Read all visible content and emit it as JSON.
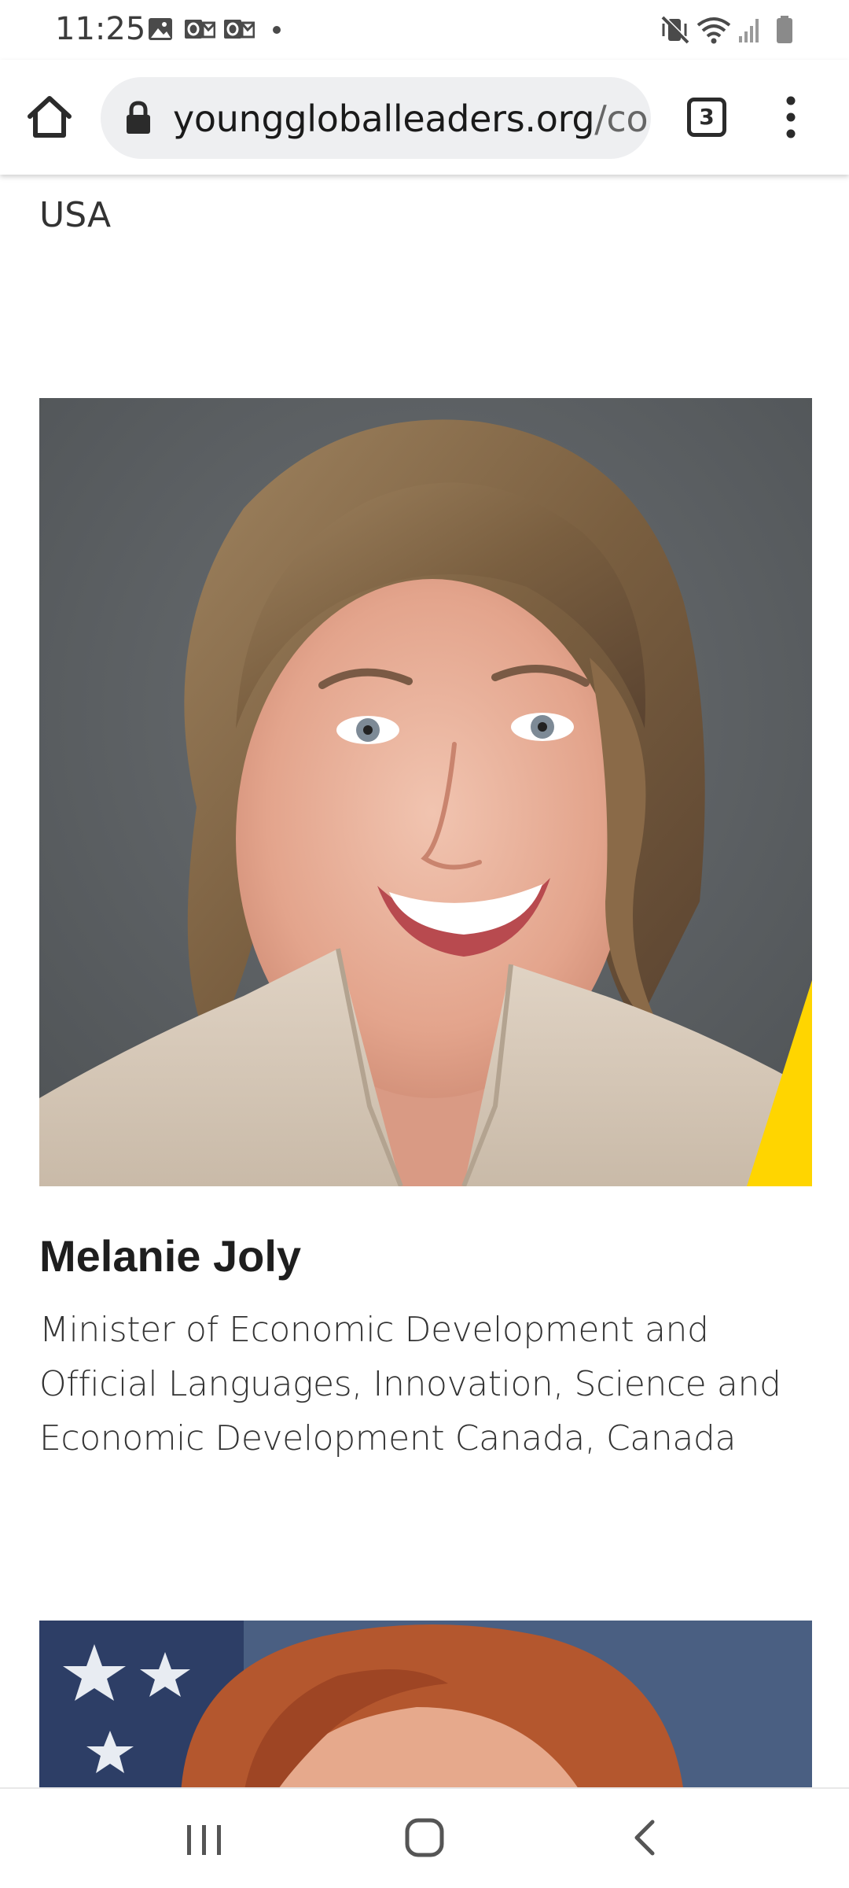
{
  "status_bar": {
    "time": "11:25",
    "notification_icons": [
      "image-icon",
      "outlook-icon",
      "outlook-icon",
      "dot-icon"
    ],
    "system_icons": [
      "vibrate-icon",
      "wifi-icon",
      "signal-icon",
      "battery-icon"
    ]
  },
  "browser": {
    "url_domain": "younggloballeaders.org",
    "url_path": "/com",
    "tab_count": "3"
  },
  "content": {
    "previous_entry_country": "USA",
    "profile": {
      "name": "Melanie Joly",
      "role": "Minister of Economic Development and Official Languages, Innovation, Science and Economic Development Canada, Canada"
    }
  },
  "colors": {
    "accent_yellow": "#ffd500",
    "portrait_background": "#5c6063"
  }
}
